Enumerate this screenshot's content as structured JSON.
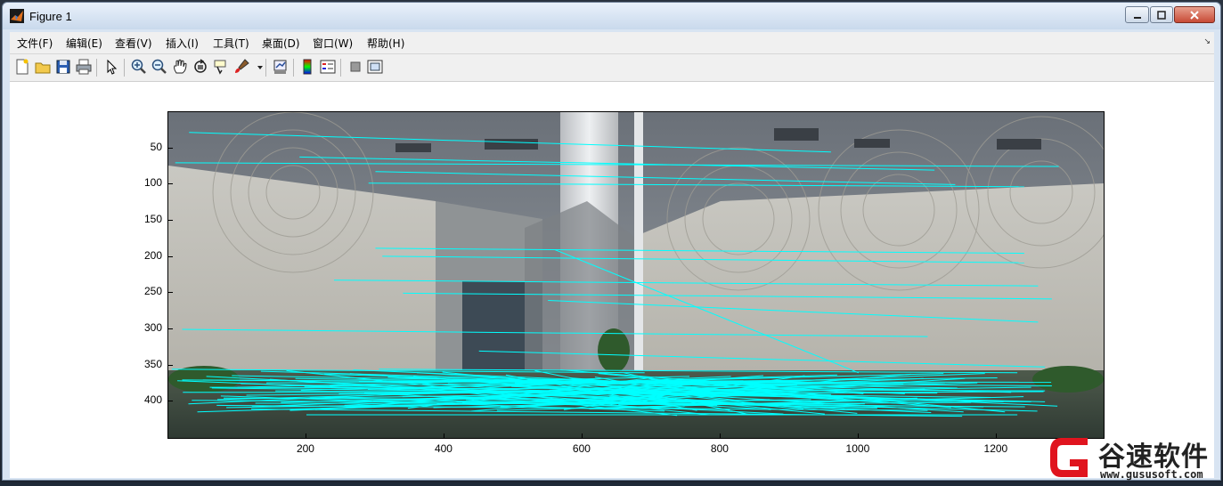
{
  "window": {
    "title": "Figure 1"
  },
  "menu": {
    "items": [
      "文件(F)",
      "编辑(E)",
      "查看(V)",
      "插入(I)",
      "工具(T)",
      "桌面(D)",
      "窗口(W)",
      "帮助(H)"
    ]
  },
  "toolbar": {
    "icons": [
      "new-figure-icon",
      "open-file-icon",
      "save-icon",
      "print-icon",
      "pointer-icon",
      "zoom-in-icon",
      "zoom-out-icon",
      "pan-icon",
      "rotate-3d-icon",
      "data-cursor-icon",
      "brush-icon",
      "dropdown-arrow-icon",
      "link-plot-icon",
      "colorbar-icon",
      "legend-icon",
      "hide-plot-tools-icon",
      "show-plot-tools-icon"
    ]
  },
  "axes": {
    "y_ticks": [
      "50",
      "100",
      "150",
      "200",
      "250",
      "300",
      "350",
      "400"
    ],
    "x_ticks": [
      "200",
      "400",
      "600",
      "800",
      "1000",
      "1200"
    ]
  },
  "chart_data": {
    "type": "scatter",
    "description_type": "image with match lines",
    "x_ticks": [
      200,
      400,
      600,
      800,
      1000,
      1200
    ],
    "y_ticks": [
      50,
      100,
      150,
      200,
      250,
      300,
      350,
      400
    ],
    "xlim": [
      0,
      1355
    ],
    "ylim": [
      450,
      0
    ],
    "line_color": "#00ffff",
    "match_lines": [
      [
        30,
        28,
        960,
        55
      ],
      [
        10,
        70,
        1290,
        75
      ],
      [
        190,
        62,
        1110,
        80
      ],
      [
        300,
        82,
        1140,
        100
      ],
      [
        290,
        98,
        1240,
        103
      ],
      [
        300,
        188,
        1240,
        195
      ],
      [
        310,
        199,
        1240,
        208
      ],
      [
        240,
        232,
        1260,
        240
      ],
      [
        340,
        250,
        1280,
        258
      ],
      [
        560,
        190,
        1000,
        360
      ],
      [
        550,
        260,
        1260,
        290
      ],
      [
        20,
        300,
        1100,
        310
      ],
      [
        450,
        330,
        1270,
        352
      ],
      [
        20,
        370,
        1280,
        378
      ],
      [
        60,
        380,
        1270,
        385
      ],
      [
        80,
        395,
        1250,
        400
      ],
      [
        70,
        405,
        1100,
        412
      ],
      [
        120,
        410,
        1150,
        420
      ],
      [
        200,
        418,
        1230,
        418
      ]
    ]
  },
  "watermark": {
    "text": "谷速软件",
    "url": "www.gususoft.com",
    "brand_color": "#e0141e"
  }
}
